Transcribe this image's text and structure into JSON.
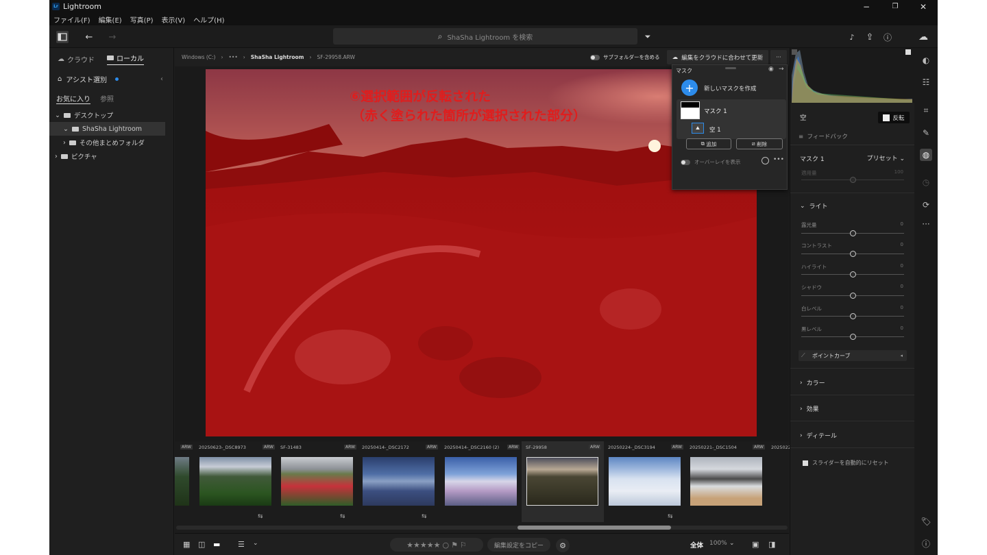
{
  "titlebar": {
    "logo": "Lr",
    "title": "Lightroom",
    "minimize": "−",
    "maximize": "❐",
    "close": "✕"
  },
  "menu": [
    "ファイル(F)",
    "編集(E)",
    "写真(P)",
    "表示(V)",
    "ヘルプ(H)"
  ],
  "toolbar": {
    "search_placeholder": "ShaSha Lightroom を検索",
    "search_icon": "magnifier-icon"
  },
  "left_panel": {
    "tabs": [
      {
        "label": "クラウド",
        "icon": "cloud-icon"
      },
      {
        "label": "ローカル",
        "icon": "folder-icon"
      }
    ],
    "assist_label": "アシスト選別",
    "subtabs": [
      "お気に入り",
      "参照"
    ],
    "tree": [
      {
        "label": "デスクトップ",
        "level": 0,
        "arrow": "⌄"
      },
      {
        "label": "ShaSha Lightroom",
        "level": 1,
        "arrow": "⌄"
      },
      {
        "label": "その他まとめフォルダ",
        "level": 1,
        "arrow": "›"
      },
      {
        "label": "ピクチャ",
        "level": 0,
        "arrow": "›"
      }
    ]
  },
  "breadcrumb": {
    "drive": "Windows (C:)",
    "ellipsis": "•••",
    "folder": "ShaSha Lightroom",
    "file": "SF-29958.ARW",
    "subfolder_toggle": "サブフォルダーを含める",
    "sync_button": "編集をクラウドに合わせて更新",
    "more": "···"
  },
  "annotation": {
    "line1": "⑥選択範囲が反転された",
    "line2": "（赤く塗られた箇所が選択された部分）"
  },
  "filmstrip": {
    "items": [
      {
        "name": "",
        "ext": "ARW",
        "edited": false
      },
      {
        "name": "20250623-_DSC8973",
        "ext": "ARW",
        "edited": true
      },
      {
        "name": "SF-31483",
        "ext": "ARW",
        "edited": true
      },
      {
        "name": "20250414-_DSC2172",
        "ext": "ARW",
        "edited": true
      },
      {
        "name": "20250414-_DSC2160 (2)",
        "ext": "ARW",
        "edited": false
      },
      {
        "name": "SF-29958",
        "ext": "ARW",
        "edited": false
      },
      {
        "name": "20250224-_DSC3194",
        "ext": "ARW",
        "edited": true
      },
      {
        "name": "20250221-_DSC1504",
        "ext": "ARW",
        "edited": false
      },
      {
        "name": "2025022",
        "ext": "",
        "edited": false
      }
    ],
    "edit_icon": "⇆"
  },
  "bottombar": {
    "stars": "★★★★★",
    "copy_settings": "編集設定をコピー",
    "zoom_fit": "全体",
    "zoom_level": "100%"
  },
  "mask_panel": {
    "title": "マスク",
    "new_mask": "新しいマスクを作成",
    "mask_name": "マスク 1",
    "component_name": "空 1",
    "add": "追加",
    "subtract": "削除",
    "overlay": "オーバーレイを表示"
  },
  "right_panel": {
    "component_title": "空",
    "invert_label": "反転",
    "feedback": "フィードバック",
    "mask_title": "マスク 1",
    "preset_label": "プリセット",
    "amount": {
      "label": "適用量",
      "value": "100"
    },
    "light_title": "ライト",
    "sliders": [
      {
        "label": "露光量",
        "value": "0"
      },
      {
        "label": "コントラスト",
        "value": "0"
      },
      {
        "label": "ハイライト",
        "value": "0"
      },
      {
        "label": "シャドウ",
        "value": "0"
      },
      {
        "label": "白レベル",
        "value": "0"
      },
      {
        "label": "黒レベル",
        "value": "0"
      }
    ],
    "point_curve": "ポイントカーブ",
    "sections": [
      "カラー",
      "効果",
      "ディテール"
    ],
    "auto_reset": "スライダーを自動的にリセット"
  },
  "icon_bar": [
    "edit-icon",
    "sliders-icon",
    "crop-icon",
    "heal-icon",
    "mask-icon",
    "history-icon",
    "versions-icon",
    "more-icon",
    "tag-icon",
    "info-icon"
  ]
}
